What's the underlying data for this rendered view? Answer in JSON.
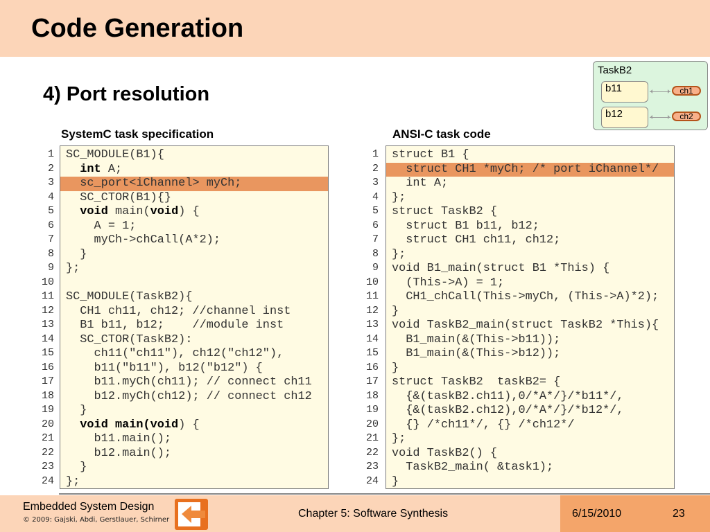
{
  "header": {
    "title": "Code Generation"
  },
  "subtitle": "4) Port resolution",
  "diagram": {
    "task": "TaskB2",
    "blocks": [
      "b11",
      "b12"
    ],
    "channels": [
      "ch1",
      "ch2"
    ]
  },
  "left": {
    "heading": "SystemC task specification",
    "highlight_line": 3,
    "lines": [
      [
        {
          "t": "SC_MODULE(B1){"
        }
      ],
      [
        {
          "t": "  "
        },
        {
          "t": "int",
          "b": true
        },
        {
          "t": " A;"
        }
      ],
      [
        {
          "t": "  sc_port<iChannel> myCh;"
        }
      ],
      [
        {
          "t": "  SC_CTOR(B1){}"
        }
      ],
      [
        {
          "t": "  "
        },
        {
          "t": "void",
          "b": true
        },
        {
          "t": " main("
        },
        {
          "t": "void",
          "b": true
        },
        {
          "t": ") {"
        }
      ],
      [
        {
          "t": "    A = 1;"
        }
      ],
      [
        {
          "t": "    myCh->chCall(A*2);"
        }
      ],
      [
        {
          "t": "  }"
        }
      ],
      [
        {
          "t": "};"
        }
      ],
      [
        {
          "t": ""
        }
      ],
      [
        {
          "t": "SC_MODULE(TaskB2){"
        }
      ],
      [
        {
          "t": "  CH1 ch11, ch12; //channel inst"
        }
      ],
      [
        {
          "t": "  B1 b11, b12;    //module inst"
        }
      ],
      [
        {
          "t": "  SC_CTOR(TaskB2):"
        }
      ],
      [
        {
          "t": "    ch11(\"ch11\"), ch12(\"ch12\"),"
        }
      ],
      [
        {
          "t": "    b11(\"b11\"), b12(\"b12\") {"
        }
      ],
      [
        {
          "t": "    b11.myCh(ch11); // connect ch11"
        }
      ],
      [
        {
          "t": "    b12.myCh(ch12); // connect ch12"
        }
      ],
      [
        {
          "t": "  }"
        }
      ],
      [
        {
          "t": "  "
        },
        {
          "t": "void main(void",
          "b": true
        },
        {
          "t": ") {"
        }
      ],
      [
        {
          "t": "    b11.main();"
        }
      ],
      [
        {
          "t": "    b12.main();"
        }
      ],
      [
        {
          "t": "  }"
        }
      ],
      [
        {
          "t": "};"
        }
      ]
    ]
  },
  "right": {
    "heading": "ANSI-C task code",
    "highlight_line": 2,
    "lines": [
      [
        {
          "t": "struct B1 {"
        }
      ],
      [
        {
          "t": "  struct CH1 *myCh; /* port iChannel*/"
        }
      ],
      [
        {
          "t": "  int A;"
        }
      ],
      [
        {
          "t": "};"
        }
      ],
      [
        {
          "t": "struct TaskB2 {"
        }
      ],
      [
        {
          "t": "  struct B1 b11, b12;"
        }
      ],
      [
        {
          "t": "  struct CH1 ch11, ch12;"
        }
      ],
      [
        {
          "t": "};"
        }
      ],
      [
        {
          "t": "void B1_main(struct B1 *This) {"
        }
      ],
      [
        {
          "t": "  (This->A) = 1;"
        }
      ],
      [
        {
          "t": "  CH1_chCall(This->myCh, (This->A)*2);"
        }
      ],
      [
        {
          "t": "}"
        }
      ],
      [
        {
          "t": "void TaskB2_main(struct TaskB2 *This){"
        }
      ],
      [
        {
          "t": "  B1_main(&(This->b11));"
        }
      ],
      [
        {
          "t": "  B1_main(&(This->b12));"
        }
      ],
      [
        {
          "t": "}"
        }
      ],
      [
        {
          "t": "struct TaskB2  taskB2= {"
        }
      ],
      [
        {
          "t": "  {&(taskB2.ch11),0/*A*/}/*b11*/,"
        }
      ],
      [
        {
          "t": "  {&(taskB2.ch12),0/*A*/}/*b12*/,"
        }
      ],
      [
        {
          "t": "  {} /*ch11*/, {} /*ch12*/"
        }
      ],
      [
        {
          "t": "};"
        }
      ],
      [
        {
          "t": "void TaskB2() {"
        }
      ],
      [
        {
          "t": "  TaskB2_main( &task1);"
        }
      ],
      [
        {
          "t": "}"
        }
      ]
    ]
  },
  "footer": {
    "course": "Embedded System Design",
    "copyright": "© 2009: Gajski, Abdi, Gerstlauer, Schirner",
    "chapter": "Chapter 5: Software Synthesis",
    "date": "6/15/2010",
    "page": "23"
  },
  "colors": {
    "header_bg": "#fcd5b8",
    "highlight": "#e9965f",
    "code_bg": "#fffbe3",
    "accent": "#e8701f"
  }
}
